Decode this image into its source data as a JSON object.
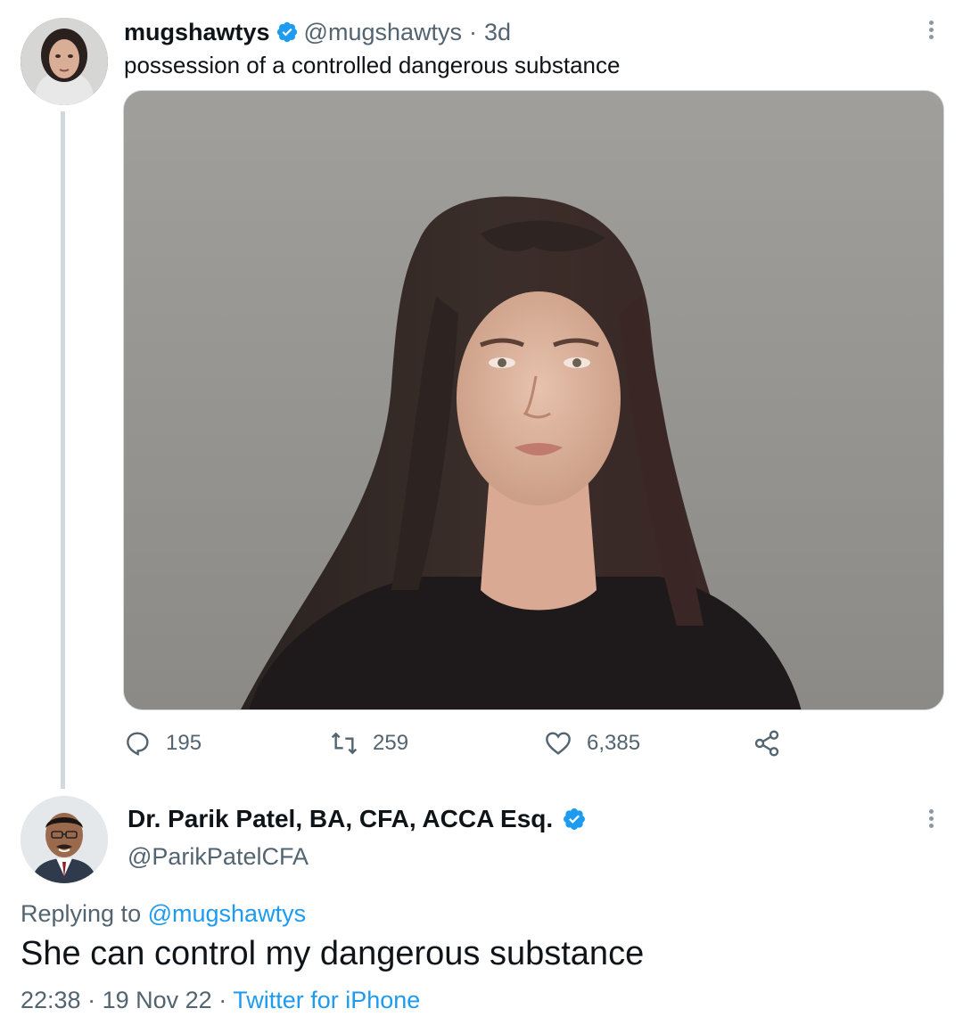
{
  "tweet": {
    "author_name": "mugshawtys",
    "author_handle": "@mugshawtys",
    "separator": "·",
    "time_ago": "3d",
    "text": "possession of a controlled dangerous substance",
    "media_icon": "photo",
    "actions": {
      "replies": "195",
      "retweets": "259",
      "likes": "6,385"
    }
  },
  "reply": {
    "author_name": "Dr. Parik Patel, BA, CFA, ACCA Esq.",
    "author_handle": "@ParikPatelCFA",
    "replying_prefix": "Replying to",
    "replying_to": "@mugshawtys",
    "text": "She can control my dangerous substance",
    "time": "22:38",
    "separator": "·",
    "date": "19 Nov 22",
    "source": "Twitter for iPhone"
  },
  "colors": {
    "accent": "#1d9bf0",
    "secondary_text": "#536471",
    "primary_text": "#0f1419",
    "thread_line": "#cfd9de"
  }
}
